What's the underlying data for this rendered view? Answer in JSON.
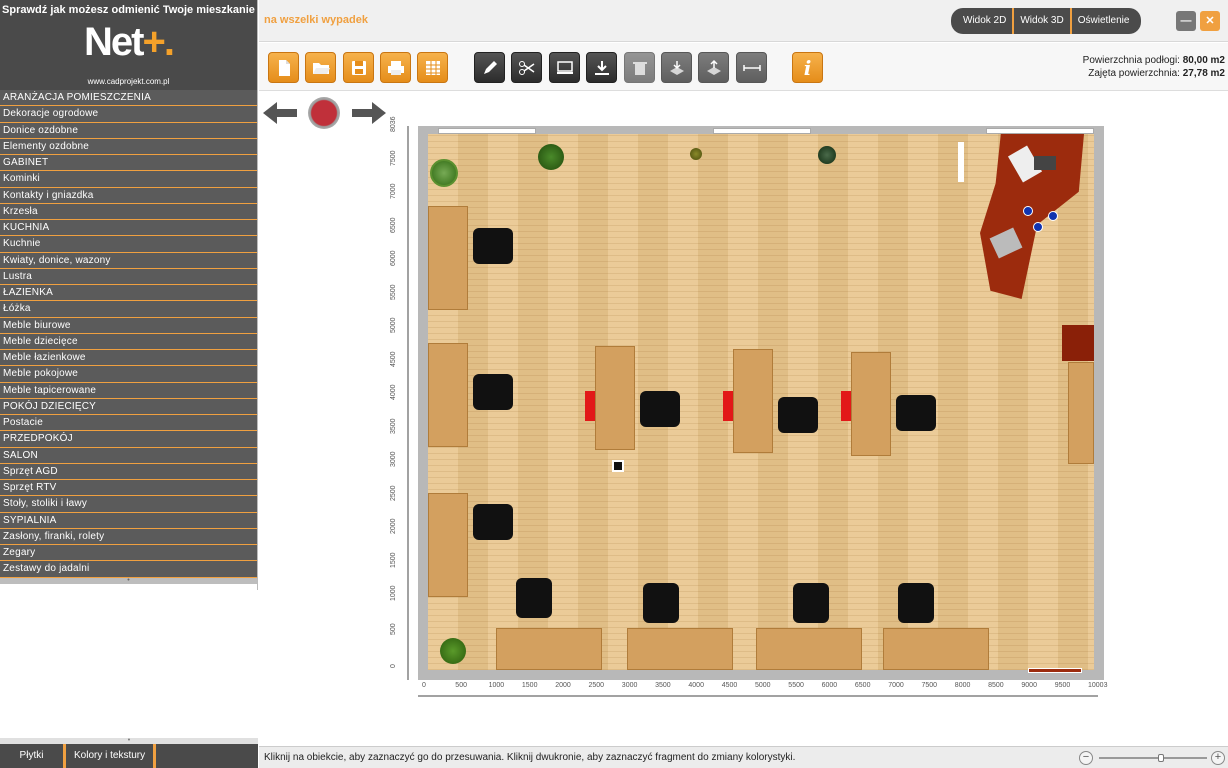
{
  "app": {
    "tagline": "Sprawdź jak możesz odmienić Twoje mieszkanie",
    "brand_main": "Net",
    "brand_plus": "+.",
    "url": "www.cadprojekt.com.pl",
    "subtitle": "na wszelki wypadek"
  },
  "categories": [
    "ARANŻACJA POMIESZCZENIA",
    "Dekoracje ogrodowe",
    "Donice ozdobne",
    "Elementy ozdobne",
    "GABINET",
    "Kominki",
    "Kontakty i gniazdka",
    "Krzesła",
    "KUCHNIA",
    "Kuchnie",
    "Kwiaty, donice, wazony",
    "Lustra",
    "ŁAZIENKA",
    "Łóżka",
    "Meble biurowe",
    "Meble dziecięce",
    "Meble łazienkowe",
    "Meble pokojowe",
    "Meble tapicerowane",
    "POKÓJ DZIECIĘCY",
    "Postacie",
    "PRZEDPOKÓJ",
    "SALON",
    "Sprzęt AGD",
    "Sprzęt RTV",
    "Stoły, stoliki i ławy",
    "SYPIALNIA",
    "Zasłony, firanki, rolety",
    "Zegary",
    "Zestawy do jadalni"
  ],
  "bottom_tabs": [
    "Płytki",
    "Kolory i tekstury"
  ],
  "view_buttons": [
    "Widok 2D",
    "Widok 3D",
    "Oświetlenie"
  ],
  "window": {
    "minimize_glyph": "—",
    "close_glyph": "✕"
  },
  "area": {
    "floor_label": "Powierzchnia podłogi:",
    "floor_value": "80,00 m2",
    "occupied_label": "Zajęta powierzchnia:",
    "occupied_value": "27,78 m2"
  },
  "toolbar": {
    "file_group": [
      "new-file-icon",
      "open-folder-icon",
      "save-icon",
      "print-icon",
      "table-icon"
    ],
    "edit_group": [
      "pen-icon",
      "scissors-icon",
      "monitor-icon",
      "download-icon",
      "trash-icon",
      "layer-down-icon",
      "layer-up-icon",
      "measure-icon"
    ],
    "info": "info-icon",
    "info_glyph": "i"
  },
  "ruler": {
    "horizontal": [
      "0",
      "500",
      "1000",
      "1500",
      "2000",
      "2500",
      "3000",
      "3500",
      "4000",
      "4500",
      "5000",
      "5500",
      "6000",
      "6500",
      "7000",
      "7500",
      "8000",
      "8500",
      "9000",
      "9500",
      "10003"
    ],
    "vertical": [
      "8036",
      "7500",
      "7000",
      "6500",
      "6000",
      "5500",
      "5000",
      "4500",
      "4000",
      "3500",
      "3000",
      "2500",
      "2000",
      "1500",
      "1000",
      "500",
      "0"
    ]
  },
  "status": {
    "text": "Kliknij na obiekcie, aby zaznaczyć go do przesuwania. Kliknij dwukronie, aby zaznaczyć fragment do zmiany kolorystyki.",
    "zoom_level": 0.55,
    "zoom_minus": "−",
    "zoom_plus": "+"
  },
  "colors": {
    "accent": "#f0a040",
    "panel_dark": "#4a4a4a",
    "floor_wood": "#e9c78f",
    "desk": "#d3a05f",
    "rug": "#9c2b0d",
    "red_block": "#e21818"
  }
}
